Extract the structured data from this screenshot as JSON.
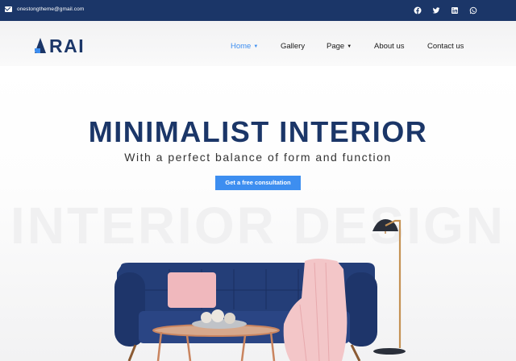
{
  "topbar": {
    "email": "onestongtheme@gmail.com",
    "social": [
      "facebook-icon",
      "twitter-icon",
      "linkedin-icon",
      "whatsapp-icon"
    ]
  },
  "logo": {
    "text": "RAI"
  },
  "nav": {
    "items": [
      {
        "label": "Home",
        "has_dropdown": true,
        "active": true
      },
      {
        "label": "Gallery",
        "has_dropdown": false
      },
      {
        "label": "Page",
        "has_dropdown": true
      },
      {
        "label": "About us",
        "has_dropdown": false
      },
      {
        "label": "Contact us",
        "has_dropdown": false
      }
    ],
    "caret": "⌄"
  },
  "hero": {
    "title": "MINIMALIST INTERIOR",
    "subtitle": "With a perfect balance of form and function",
    "cta_label": "Get a free consultation",
    "background_word": "INTERIOR DESIGN"
  },
  "colors": {
    "brand": "#1b3668",
    "accent": "#3d8ef0",
    "sofa": "#243e78",
    "pink": "#f0b8bd",
    "copper": "#c9845f"
  }
}
